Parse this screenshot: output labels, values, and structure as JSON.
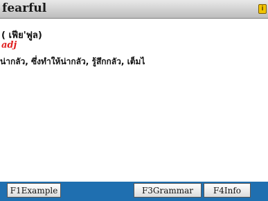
{
  "header": {
    "word": "fearful",
    "icon": "info-badge-icon",
    "icon_glyph": "i"
  },
  "entry": {
    "pronunciation": "( เฟีย'ฟูล)",
    "part_of_speech": "adj",
    "meaning": "น่ากลัว, ซึ่งทำให้น่ากลัว, รู้สึกกลัว, เต็มไ"
  },
  "softkeys": {
    "f1": "F1Example",
    "f3": "F3Grammar",
    "f4": "F4Info"
  },
  "colors": {
    "accent_bar": "#1f6fb0",
    "pos_text": "#e02020",
    "icon": "#f1c400"
  }
}
